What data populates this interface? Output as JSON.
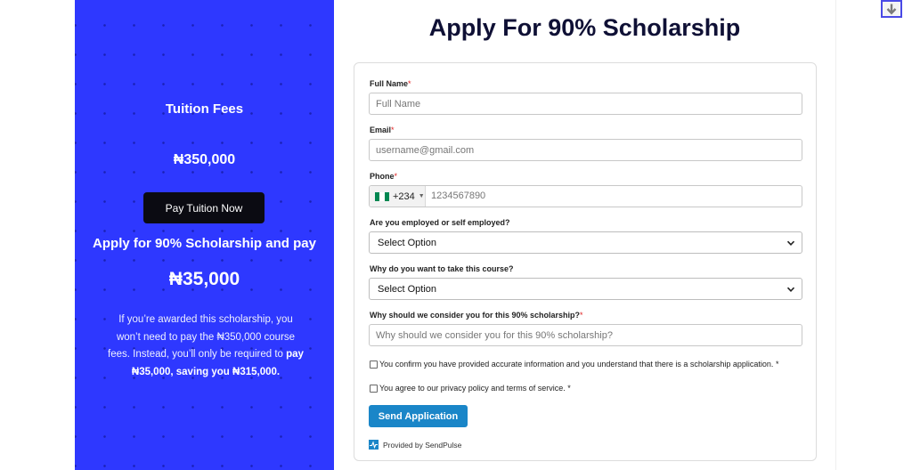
{
  "promo": {
    "tuition_title": "Tuition Fees",
    "tuition_amount": "₦350,000",
    "pay_button": "Pay Tuition Now",
    "apply_line": "Apply for 90% Scholarship and pay",
    "apply_amount": "₦35,000",
    "blurb_plain": "If you’re awarded this scholarship, you won’t need to pay the ₦350,000 course fees. Instead, you’ll only be required to ",
    "blurb_bold": "pay ₦35,000, saving you ₦315,000."
  },
  "form": {
    "title": "Apply For 90% Scholarship",
    "full_name": {
      "label": "Full Name",
      "placeholder": "Full Name"
    },
    "email": {
      "label": "Email",
      "placeholder": "username@gmail.com"
    },
    "phone": {
      "label": "Phone",
      "country_code": "+234",
      "placeholder": "1234567890"
    },
    "employed": {
      "label": "Are you employed or self employed?",
      "value": "Select Option"
    },
    "why_course": {
      "label": "Why do you want to take this course?",
      "value": "Select Option"
    },
    "why_consider": {
      "label": "Why should we consider you for this 90% scholarship?",
      "placeholder": "Why should we consider you for this 90% scholarship?"
    },
    "required_mark": "*",
    "confirm_check": "You confirm you have provided accurate information and you understand that there is a scholarship application. *",
    "privacy_check": "You agree to our privacy policy and terms of service. *",
    "submit": "Send Application",
    "provided_by": "Provided by SendPulse"
  },
  "colors": {
    "promo_bg": "#2e38ff",
    "button_dark": "#0b0b12",
    "submit_blue": "#1a86c8",
    "title_navy": "#0f1035",
    "required_red": "#e02424"
  },
  "icons": [
    "nigeria-flag-icon",
    "chevron-down-icon",
    "sendpulse-logo-icon",
    "scroll-down-arrow-icon"
  ]
}
